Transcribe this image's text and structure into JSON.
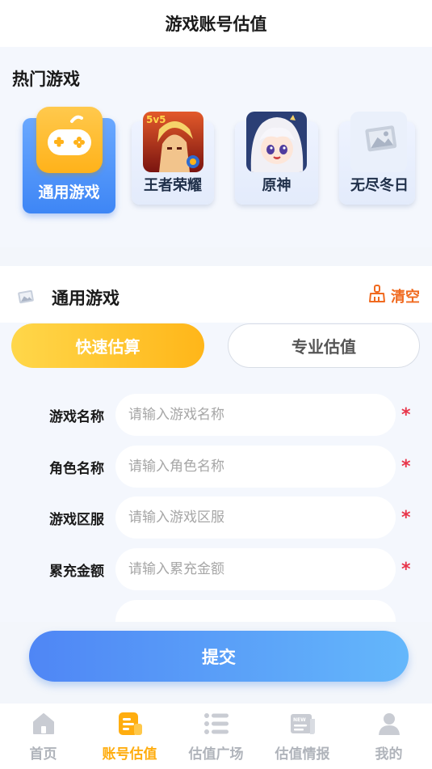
{
  "header": {
    "title": "游戏账号估值"
  },
  "hot": {
    "title": "热门游戏",
    "games": [
      {
        "label": "通用游戏",
        "icon": "gamepad-icon",
        "selected": true
      },
      {
        "label": "王者荣耀",
        "icon": "game-thumbnail",
        "badge": "5v5"
      },
      {
        "label": "原神",
        "icon": "game-thumbnail"
      },
      {
        "label": "无尽冬日",
        "icon": "image-placeholder-icon"
      }
    ]
  },
  "form": {
    "title": "通用游戏",
    "clear_label": "清空",
    "tabs": {
      "fast": "快速估算",
      "pro": "专业估值"
    },
    "fields": [
      {
        "label": "游戏名称",
        "placeholder": "请输入游戏名称",
        "required": "*"
      },
      {
        "label": "角色名称",
        "placeholder": "请输入角色名称",
        "required": "*"
      },
      {
        "label": "游戏区服",
        "placeholder": "请输入游戏区服",
        "required": "*"
      },
      {
        "label": "累充金额",
        "placeholder": "请输入累充金额",
        "required": "*"
      }
    ],
    "submit_label": "提交"
  },
  "tabbar": {
    "items": [
      {
        "label": "首页",
        "icon": "home-icon"
      },
      {
        "label": "账号估值",
        "icon": "valuation-icon",
        "active": true
      },
      {
        "label": "估值广场",
        "icon": "list-icon"
      },
      {
        "label": "估值情报",
        "icon": "news-icon"
      },
      {
        "label": "我的",
        "icon": "profile-icon"
      }
    ]
  },
  "colors": {
    "accent_orange": "#ffad0f",
    "primary_blue": "#4f86f5",
    "required_red": "#e8354a",
    "clear_orange": "#f06a1f"
  }
}
